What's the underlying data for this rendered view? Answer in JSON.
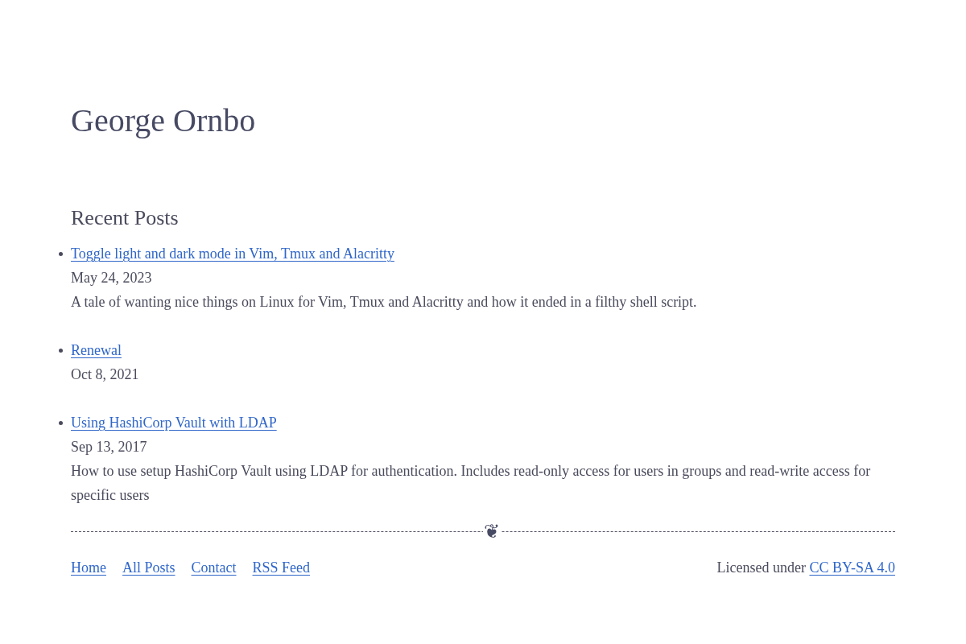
{
  "site_title": "George Ornbo",
  "section_heading": "Recent Posts",
  "posts": [
    {
      "title": "Toggle light and dark mode in Vim, Tmux and Alacritty",
      "date": "May 24, 2023",
      "summary": "A tale of wanting nice things on Linux for Vim, Tmux and Alacritty and how it ended in a filthy shell script."
    },
    {
      "title": "Renewal",
      "date": "Oct 8, 2021"
    },
    {
      "title": "Using HashiCorp Vault with LDAP",
      "date": "Sep 13, 2017",
      "summary": "How to use setup HashiCorp Vault using LDAP for authentication. Includes read-only access for users in groups and read-write access for specific users"
    }
  ],
  "divider": {
    "ornament": "❦"
  },
  "footer": {
    "links": [
      "Home",
      "All Posts",
      "Contact",
      "RSS Feed"
    ],
    "license": {
      "text": "Licensed under",
      "link": "CC BY-SA 4.0"
    }
  }
}
